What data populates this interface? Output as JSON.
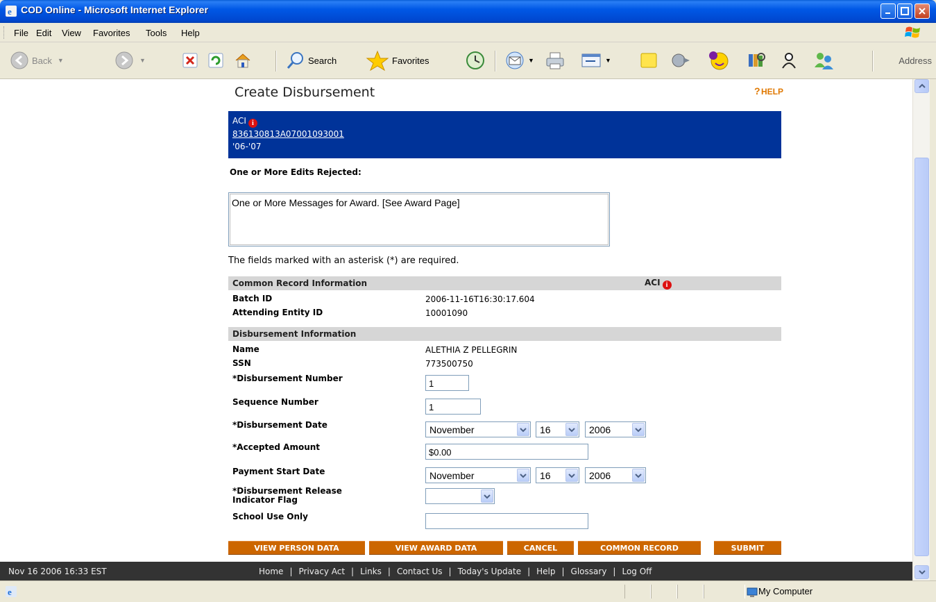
{
  "window": {
    "title": "COD Online - Microsoft Internet Explorer"
  },
  "menu": [
    "File",
    "Edit",
    "View",
    "Favorites",
    "Tools",
    "Help"
  ],
  "toolbar": {
    "back": "Back",
    "search": "Search",
    "favorites": "Favorites",
    "address": "Address"
  },
  "page": {
    "heading": "Create Disbursement",
    "help": "HELP",
    "header_box": {
      "line1": "ACI",
      "award_id": "836130813A07001093001",
      "year": "'06-'07"
    },
    "edits_label": "One or More Edits Rejected:",
    "messages": "One or More Messages for Award. [See Award Page]",
    "required_note": "The fields marked with an asterisk (*) are required.",
    "common_section": {
      "title": "Common Record Information",
      "aci": "ACI"
    },
    "common_fields": [
      {
        "label": "Batch ID",
        "value": "2006-11-16T16:30:17.604"
      },
      {
        "label": "Attending Entity ID",
        "value": "10001090"
      }
    ],
    "disb_section": {
      "title": "Disbursement Information"
    },
    "disb_fields": {
      "name_label": "Name",
      "name_value": "ALETHIA Z PELLEGRIN",
      "ssn_label": "SSN",
      "ssn_value": "773500750",
      "disb_number_label": "*Disbursement Number",
      "disb_number_value": "1",
      "seq_number_label": "Sequence Number",
      "seq_number_value": "1",
      "disb_date_label": "*Disbursement Date",
      "disb_date_month": "November",
      "disb_date_day": "16",
      "disb_date_year": "2006",
      "accepted_amount_label": "*Accepted Amount",
      "accepted_amount_value": "$0.00",
      "pay_start_label": "Payment Start Date",
      "pay_start_month": "November",
      "pay_start_day": "16",
      "pay_start_year": "2006",
      "release_flag_label_1": "*Disbursement Release",
      "release_flag_label_2": "Indicator Flag",
      "release_flag_value": "",
      "school_use_label": "School Use Only",
      "school_use_value": ""
    },
    "buttons": {
      "view_person": "VIEW PERSON DATA",
      "view_award": "VIEW AWARD DATA",
      "cancel": "CANCEL",
      "common_record": "COMMON RECORD",
      "submit": "SUBMIT"
    },
    "footer": {
      "timestamp": "Nov 16 2006 16:33 EST",
      "links": [
        "Home",
        "Privacy Act",
        "Links",
        "Contact Us",
        "Today's Update",
        "Help",
        "Glossary",
        "Log Off"
      ]
    }
  },
  "statusbar": {
    "zone": "My Computer"
  },
  "colors": {
    "header_blue": "#003399",
    "button_orange": "#cc6600",
    "section_gray": "#d6d6d6",
    "footer_dark": "#333333"
  }
}
